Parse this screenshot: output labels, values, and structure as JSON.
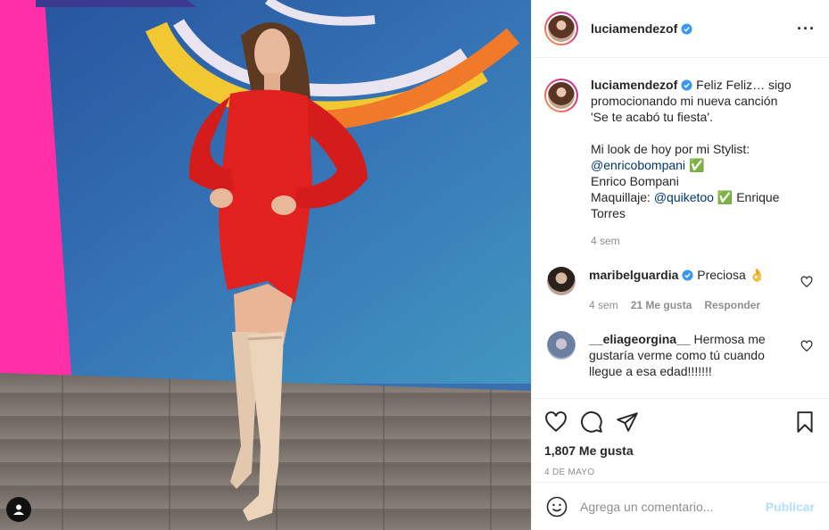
{
  "header": {
    "username": "luciamendezof",
    "more_icon": "more-horizontal-icon"
  },
  "caption": {
    "username": "luciamendezof",
    "line1": "Feliz Feliz… sigo promocionando mi nueva canción 'Se te acabó tu fiesta'.",
    "line2": "Mi look de hoy por mi Stylist:",
    "mention1": "@enricobompani",
    "check1": "✅",
    "line3": "Enrico Bompani",
    "line4_prefix": "Maquillaje:",
    "mention2": "@quiketoo",
    "check2": "✅",
    "line4_suffix": "Enrique Torres",
    "time": "4 sem"
  },
  "comments": [
    {
      "username": "maribelguardia",
      "verified": true,
      "text": "Preciosa",
      "emoji": "👌",
      "time": "4 sem",
      "likes": "21 Me gusta",
      "reply": "Responder"
    },
    {
      "username": "__eliageorgina__",
      "verified": false,
      "text": "Hermosa me gustaría verme como tú cuando llegue a esa edad!!!!!!!"
    }
  ],
  "actions": {
    "likes": "1,807 Me gusta",
    "date": "4 DE MAYO"
  },
  "add_comment": {
    "placeholder": "Agrega un comentario...",
    "publish": "Publicar"
  },
  "colors": {
    "accent_link": "#00376b",
    "publish_disabled": "#b2dffc",
    "verified_blue": "#3897f0",
    "dress_red": "#e0211f",
    "pink_panel": "#ff2fa8"
  }
}
